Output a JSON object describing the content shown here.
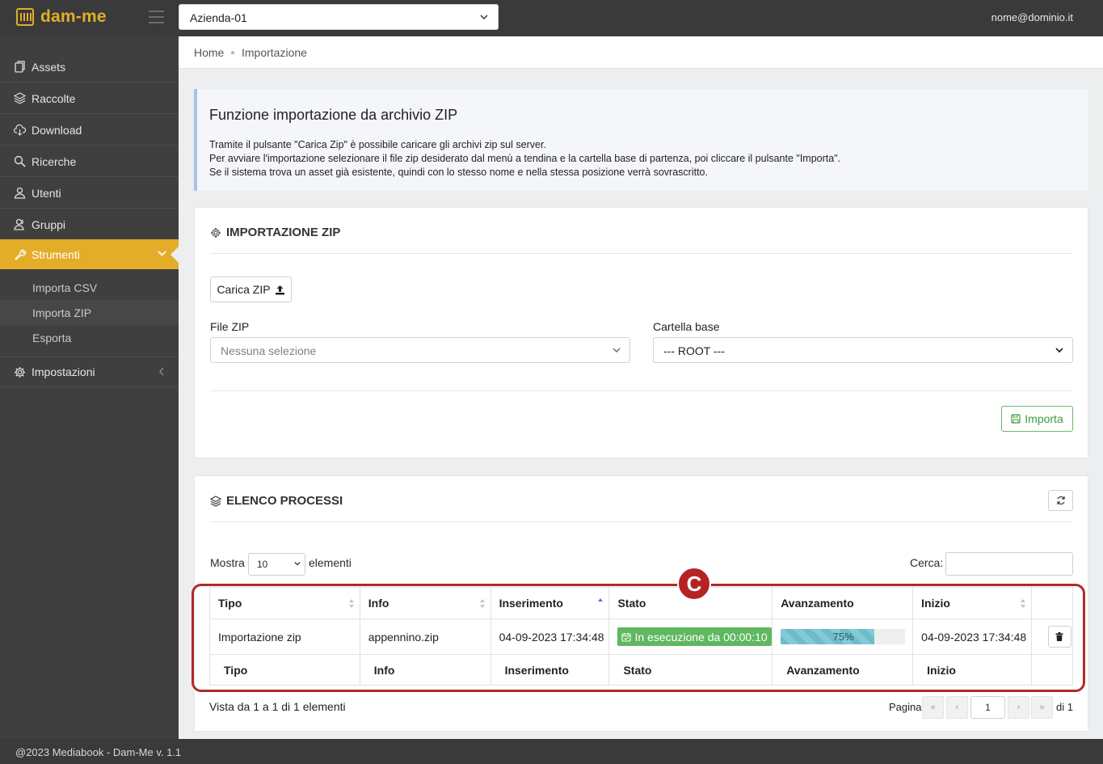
{
  "topbar": {
    "logo_text": "dam-me",
    "company": "Azienda-01",
    "user_email": "nome@dominio.it"
  },
  "sidebar": {
    "items": [
      {
        "label": "Assets",
        "icon": "assets-icon"
      },
      {
        "label": "Raccolte",
        "icon": "layers-icon"
      },
      {
        "label": "Download",
        "icon": "cloud-download-icon"
      },
      {
        "label": "Ricerche",
        "icon": "search-icon"
      },
      {
        "label": "Utenti",
        "icon": "user-icon"
      },
      {
        "label": "Gruppi",
        "icon": "group-icon"
      },
      {
        "label": "Strumenti",
        "icon": "wrench-icon"
      },
      {
        "label": "Impostazioni",
        "icon": "gear-icon"
      }
    ],
    "subitems": [
      "Importa CSV",
      "Importa ZIP",
      "Esporta"
    ]
  },
  "breadcrumb": {
    "home": "Home",
    "current": "Importazione"
  },
  "info": {
    "title": "Funzione importazione da archivio ZIP",
    "line1": "Tramite il pulsante \"Carica Zip\" è possibile caricare gli archivi zip sul server.",
    "line2": "Per avviare l'importazione selezionare il file zip desiderato dal menù a tendina e la cartella base di partenza, poi cliccare il pulsante \"Importa\".",
    "line3": "Se il sistema trova un asset già esistente, quindi con lo stesso nome e nella stessa posizione verrà sovrascritto."
  },
  "import_card": {
    "title": "IMPORTAZIONE ZIP",
    "upload_label": "Carica ZIP",
    "file_label": "File ZIP",
    "file_placeholder": "Nessuna selezione",
    "folder_label": "Cartella base",
    "folder_value": "--- ROOT ---",
    "import_label": "Importa"
  },
  "process_card": {
    "title": "ELENCO PROCESSI",
    "show_label": "Mostra",
    "page_length": "10",
    "elements_label": "elementi",
    "search_label": "Cerca:",
    "columns": [
      "Tipo",
      "Info",
      "Inserimento",
      "Stato",
      "Avanzamento",
      "Inizio"
    ],
    "rows": [
      {
        "tipo": "Importazione zip",
        "info": "appennino.zip",
        "inserimento": "04-09-2023 17:34:48",
        "stato": "In esecuzione da 00:00:10",
        "avanzamento": 75,
        "avanzamento_label": "75%",
        "inizio": "04-09-2023 17:34:48"
      }
    ],
    "summary": "Vista da 1 a 1 di 1 elementi",
    "page_label": "Pagina",
    "page": "1",
    "of_label": "di 1"
  },
  "callout_letter": "C",
  "footer": "@2023 Mediabook - Dam-Me v. 1.1",
  "colors": {
    "accent": "#e3ad2a",
    "highlight": "#b02a2a",
    "success": "#5fb760"
  }
}
